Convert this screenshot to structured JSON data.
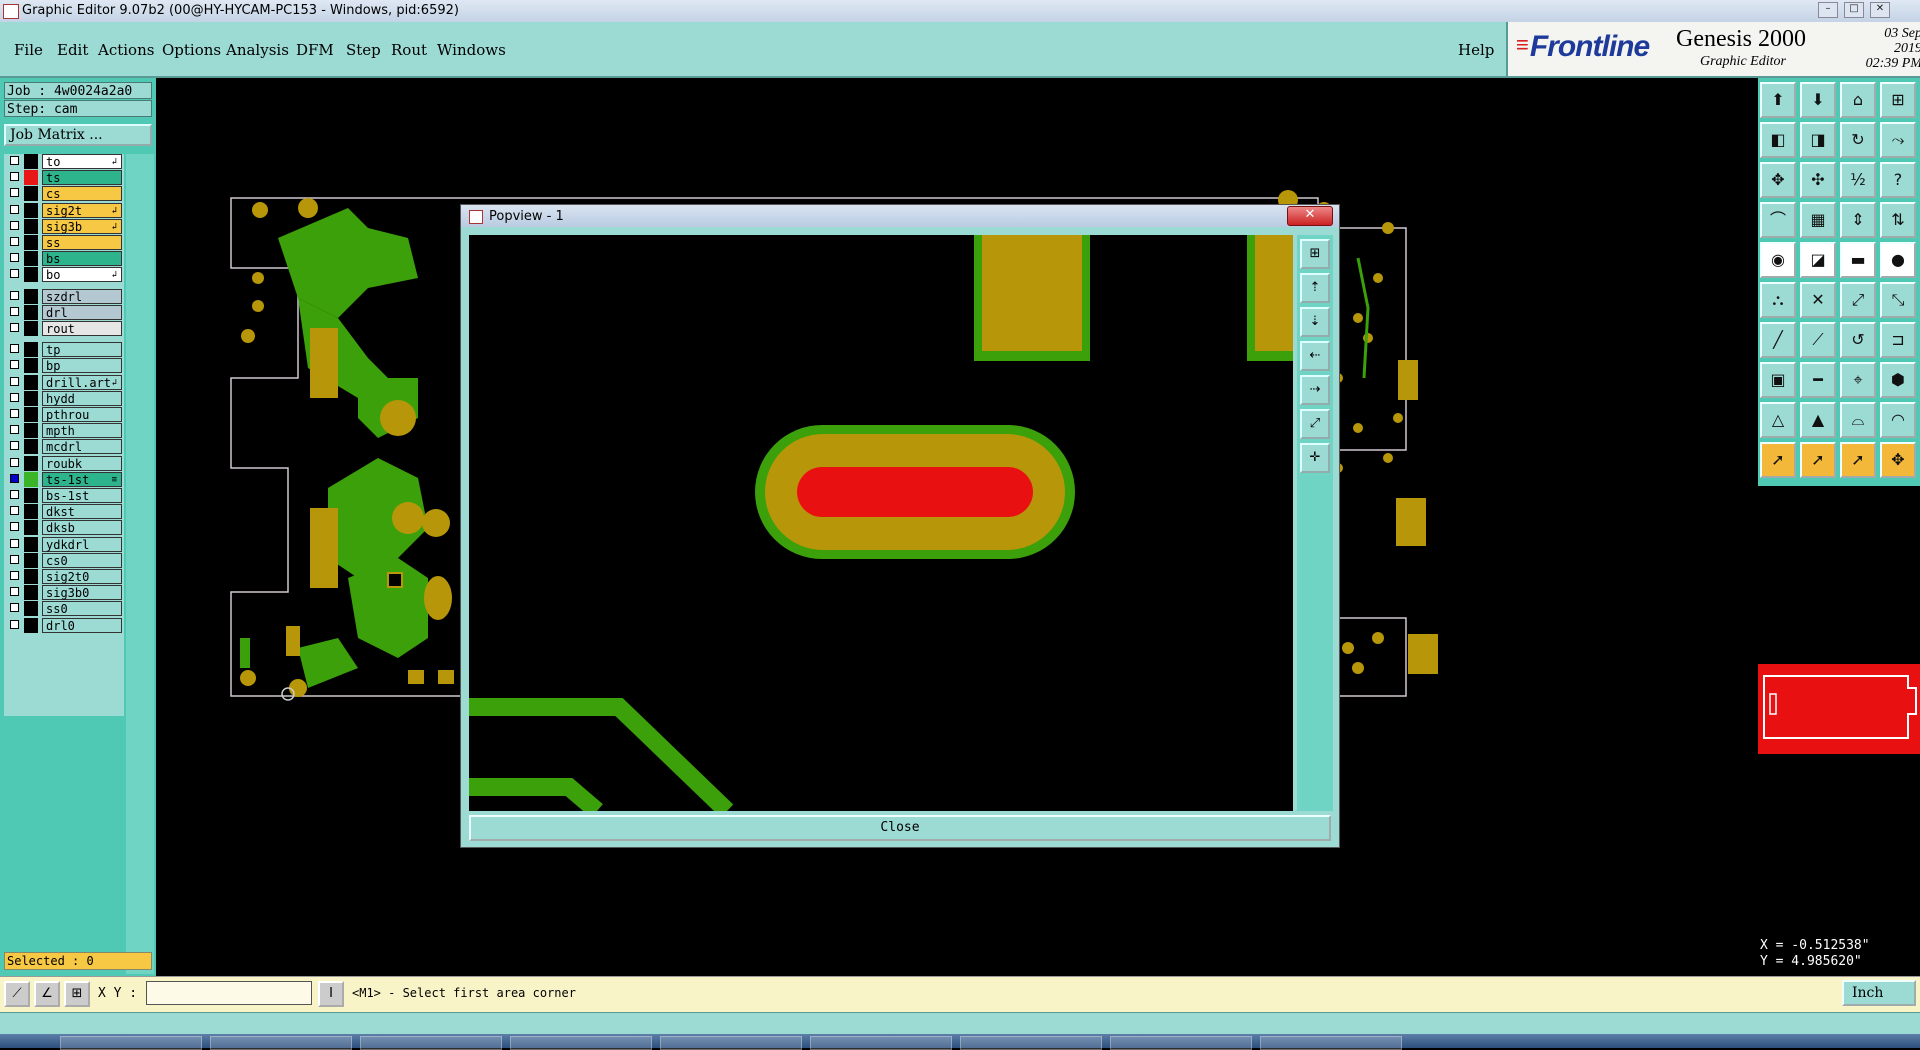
{
  "window": {
    "title": "Graphic Editor 9.07b2 (00@HY-HYCAM-PC153 - Windows, pid:6592)"
  },
  "menu": {
    "items": [
      "File",
      "Edit",
      "Actions",
      "Options",
      "Analysis",
      "DFM",
      "Step",
      "Rout",
      "Windows"
    ],
    "help": "Help"
  },
  "brand": {
    "logo": "Frontline",
    "product": "Genesis 2000",
    "subtitle": "Graphic Editor",
    "date": "03 Sep 2019",
    "time": "02:39 PM"
  },
  "job": {
    "job": "Job : 4w0024a2a0",
    "step": "Step: cam",
    "matrix_button": "Job Matrix ..."
  },
  "layers": [
    {
      "name": "to",
      "color": "#ffffff",
      "swatch": "#000000",
      "flag": "↲",
      "group": 0
    },
    {
      "name": "ts",
      "color": "#2db48c",
      "swatch": "#e81818",
      "flag": "",
      "group": 0
    },
    {
      "name": "cs",
      "color": "#f6c843",
      "swatch": "#000000",
      "flag": "",
      "group": 0
    },
    {
      "name": "sig2t",
      "color": "#f6c843",
      "swatch": "#000000",
      "flag": "↲",
      "group": 0
    },
    {
      "name": "sig3b",
      "color": "#f6c843",
      "swatch": "#000000",
      "flag": "↲",
      "group": 0
    },
    {
      "name": "ss",
      "color": "#f6c843",
      "swatch": "#000000",
      "flag": "",
      "group": 0
    },
    {
      "name": "bs",
      "color": "#2db48c",
      "swatch": "#000000",
      "flag": "",
      "group": 0
    },
    {
      "name": "bo",
      "color": "#ffffff",
      "swatch": "#000000",
      "flag": "↲",
      "group": 0
    },
    {
      "name": "szdrl",
      "color": "#b4c8d2",
      "swatch": "#000000",
      "flag": "",
      "group": 1
    },
    {
      "name": "drl",
      "color": "#b4c8d2",
      "swatch": "#000000",
      "flag": "",
      "group": 1
    },
    {
      "name": "rout",
      "color": "#e6e6e6",
      "swatch": "#000000",
      "flag": "",
      "group": 1
    },
    {
      "name": "tp",
      "color": "#9cdad4",
      "swatch": "#000000",
      "flag": "",
      "group": 2
    },
    {
      "name": "bp",
      "color": "#9cdad4",
      "swatch": "#000000",
      "flag": "",
      "group": 2
    },
    {
      "name": "drill.art",
      "color": "#9cdad4",
      "swatch": "#000000",
      "flag": "↲",
      "group": 2
    },
    {
      "name": "hydd",
      "color": "#9cdad4",
      "swatch": "#000000",
      "flag": "",
      "group": 2
    },
    {
      "name": "pthrou",
      "color": "#9cdad4",
      "swatch": "#000000",
      "flag": "",
      "group": 2
    },
    {
      "name": "mpth",
      "color": "#9cdad4",
      "swatch": "#000000",
      "flag": "",
      "group": 2
    },
    {
      "name": "mcdrl",
      "color": "#9cdad4",
      "swatch": "#000000",
      "flag": "",
      "group": 2
    },
    {
      "name": "roubk",
      "color": "#9cdad4",
      "swatch": "#000000",
      "flag": "",
      "group": 2
    },
    {
      "name": "ts-1st",
      "color": "#2db48c",
      "swatch": "#3cb428",
      "flag": "≡",
      "group": 2,
      "checked": true
    },
    {
      "name": "bs-1st",
      "color": "#9cdad4",
      "swatch": "#000000",
      "flag": "",
      "group": 2
    },
    {
      "name": "dkst",
      "color": "#9cdad4",
      "swatch": "#000000",
      "flag": "",
      "group": 2
    },
    {
      "name": "dksb",
      "color": "#9cdad4",
      "swatch": "#000000",
      "flag": "",
      "group": 2
    },
    {
      "name": "ydkdrl",
      "color": "#9cdad4",
      "swatch": "#000000",
      "flag": "",
      "group": 2
    },
    {
      "name": "cs0",
      "color": "#9cdad4",
      "swatch": "#000000",
      "flag": "",
      "group": 2
    },
    {
      "name": "sig2t0",
      "color": "#9cdad4",
      "swatch": "#000000",
      "flag": "",
      "group": 2
    },
    {
      "name": "sig3b0",
      "color": "#9cdad4",
      "swatch": "#000000",
      "flag": "",
      "group": 2
    },
    {
      "name": "ss0",
      "color": "#9cdad4",
      "swatch": "#000000",
      "flag": "",
      "group": 2
    },
    {
      "name": "drl0",
      "color": "#9cdad4",
      "swatch": "#000000",
      "flag": "",
      "group": 2
    }
  ],
  "selected": "Selected : 0",
  "popview": {
    "title": "Popview - 1",
    "close_button": "Close"
  },
  "coords": {
    "x": "X = -0.512538\"",
    "y": "Y = 4.985620\""
  },
  "bottom": {
    "xy_label": "X Y :",
    "xy_value": "",
    "prompt": "<M1> - Select first area corner",
    "unit": "Inch"
  },
  "colors": {
    "panel": "#9cdad4",
    "copper": "#3ca00a",
    "pad": "#b8960a",
    "highlight": "#e81010"
  }
}
